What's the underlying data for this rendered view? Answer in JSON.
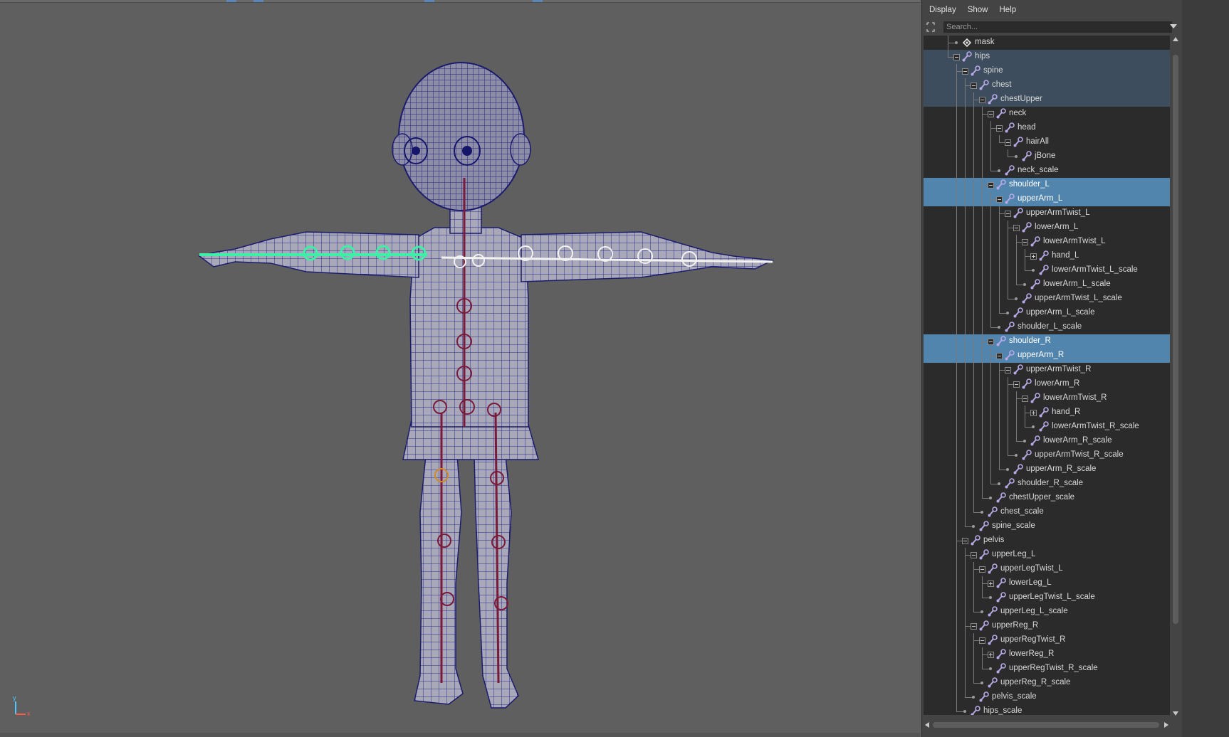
{
  "outliner": {
    "menu": [
      "Display",
      "Show",
      "Help"
    ],
    "search": {
      "placeholder": "Search..."
    },
    "rows": [
      {
        "label": "mask",
        "depth": 1,
        "icon": "transform-icon",
        "state": "leaf",
        "sel": 0
      },
      {
        "label": "hips",
        "depth": 1,
        "icon": "joint-icon",
        "state": "open",
        "sel": 1
      },
      {
        "label": "spine",
        "depth": 2,
        "icon": "joint-icon",
        "state": "open",
        "sel": 1
      },
      {
        "label": "chest",
        "depth": 3,
        "icon": "joint-icon",
        "state": "open",
        "sel": 1
      },
      {
        "label": "chestUpper",
        "depth": 4,
        "icon": "joint-icon",
        "state": "open",
        "sel": 1
      },
      {
        "label": "neck",
        "depth": 5,
        "icon": "joint-icon",
        "state": "open",
        "sel": 0
      },
      {
        "label": "head",
        "depth": 6,
        "icon": "joint-icon",
        "state": "open",
        "sel": 0
      },
      {
        "label": "hairAll",
        "depth": 7,
        "icon": "joint-icon",
        "state": "open",
        "sel": 0
      },
      {
        "label": "jBone",
        "depth": 8,
        "icon": "joint-icon",
        "state": "leaf",
        "sel": 0
      },
      {
        "label": "neck_scale",
        "depth": 6,
        "icon": "joint-icon",
        "state": "leaf",
        "sel": 0
      },
      {
        "label": "shoulder_L",
        "depth": 5,
        "icon": "joint-icon",
        "state": "open",
        "sel": 2
      },
      {
        "label": "upperArm_L",
        "depth": 6,
        "icon": "joint-icon",
        "state": "open",
        "sel": 2
      },
      {
        "label": "upperArmTwist_L",
        "depth": 7,
        "icon": "joint-icon",
        "state": "open",
        "sel": 0
      },
      {
        "label": "lowerArm_L",
        "depth": 8,
        "icon": "joint-icon",
        "state": "open",
        "sel": 0
      },
      {
        "label": "lowerArmTwist_L",
        "depth": 9,
        "icon": "joint-icon",
        "state": "open",
        "sel": 0
      },
      {
        "label": "hand_L",
        "depth": 10,
        "icon": "joint-icon",
        "state": "closed",
        "sel": 0
      },
      {
        "label": "lowerArmTwist_L_scale",
        "depth": 10,
        "icon": "joint-icon",
        "state": "leaf",
        "sel": 0
      },
      {
        "label": "lowerArm_L_scale",
        "depth": 9,
        "icon": "joint-icon",
        "state": "leaf",
        "sel": 0
      },
      {
        "label": "upperArmTwist_L_scale",
        "depth": 8,
        "icon": "joint-icon",
        "state": "leaf",
        "sel": 0
      },
      {
        "label": "upperArm_L_scale",
        "depth": 7,
        "icon": "joint-icon",
        "state": "leaf",
        "sel": 0
      },
      {
        "label": "shoulder_L_scale",
        "depth": 6,
        "icon": "joint-icon",
        "state": "leaf",
        "sel": 0
      },
      {
        "label": "shoulder_R",
        "depth": 5,
        "icon": "joint-icon",
        "state": "open",
        "sel": 2
      },
      {
        "label": "upperArm_R",
        "depth": 6,
        "icon": "joint-icon",
        "state": "open",
        "sel": 2
      },
      {
        "label": "upperArmTwist_R",
        "depth": 7,
        "icon": "joint-icon",
        "state": "open",
        "sel": 0
      },
      {
        "label": "lowerArm_R",
        "depth": 8,
        "icon": "joint-icon",
        "state": "open",
        "sel": 0
      },
      {
        "label": "lowerArmTwist_R",
        "depth": 9,
        "icon": "joint-icon",
        "state": "open",
        "sel": 0
      },
      {
        "label": "hand_R",
        "depth": 10,
        "icon": "joint-icon",
        "state": "closed",
        "sel": 0
      },
      {
        "label": "lowerArmTwist_R_scale",
        "depth": 10,
        "icon": "joint-icon",
        "state": "leaf",
        "sel": 0
      },
      {
        "label": "lowerArm_R_scale",
        "depth": 9,
        "icon": "joint-icon",
        "state": "leaf",
        "sel": 0
      },
      {
        "label": "upperArmTwist_R_scale",
        "depth": 8,
        "icon": "joint-icon",
        "state": "leaf",
        "sel": 0
      },
      {
        "label": "upperArm_R_scale",
        "depth": 7,
        "icon": "joint-icon",
        "state": "leaf",
        "sel": 0
      },
      {
        "label": "shoulder_R_scale",
        "depth": 6,
        "icon": "joint-icon",
        "state": "leaf",
        "sel": 0
      },
      {
        "label": "chestUpper_scale",
        "depth": 5,
        "icon": "joint-icon",
        "state": "leaf",
        "sel": 0
      },
      {
        "label": "chest_scale",
        "depth": 4,
        "icon": "joint-icon",
        "state": "leaf",
        "sel": 0
      },
      {
        "label": "spine_scale",
        "depth": 3,
        "icon": "joint-icon",
        "state": "leaf",
        "sel": 0
      },
      {
        "label": "pelvis",
        "depth": 2,
        "icon": "joint-icon",
        "state": "open",
        "sel": 0
      },
      {
        "label": "upperLeg_L",
        "depth": 3,
        "icon": "joint-icon",
        "state": "open",
        "sel": 0
      },
      {
        "label": "upperLegTwist_L",
        "depth": 4,
        "icon": "joint-icon",
        "state": "open",
        "sel": 0
      },
      {
        "label": "lowerLeg_L",
        "depth": 5,
        "icon": "joint-icon",
        "state": "closed",
        "sel": 0
      },
      {
        "label": "upperLegTwist_L_scale",
        "depth": 5,
        "icon": "joint-icon",
        "state": "leaf",
        "sel": 0
      },
      {
        "label": "upperLeg_L_scale",
        "depth": 4,
        "icon": "joint-icon",
        "state": "leaf",
        "sel": 0
      },
      {
        "label": "upperReg_R",
        "depth": 3,
        "icon": "joint-icon",
        "state": "open",
        "sel": 0
      },
      {
        "label": "upperRegTwist_R",
        "depth": 4,
        "icon": "joint-icon",
        "state": "open",
        "sel": 0
      },
      {
        "label": "lowerReg_R",
        "depth": 5,
        "icon": "joint-icon",
        "state": "closed",
        "sel": 0
      },
      {
        "label": "upperRegTwist_R_scale",
        "depth": 5,
        "icon": "joint-icon",
        "state": "leaf",
        "sel": 0
      },
      {
        "label": "upperReg_R_scale",
        "depth": 4,
        "icon": "joint-icon",
        "state": "leaf",
        "sel": 0
      },
      {
        "label": "pelvis_scale",
        "depth": 3,
        "icon": "joint-icon",
        "state": "leaf",
        "sel": 0
      },
      {
        "label": "hips_scale",
        "depth": 2,
        "icon": "joint-icon",
        "state": "leaf",
        "sel": 0
      }
    ]
  },
  "viewport": {
    "axis_labels": {
      "y": "y",
      "x": "x"
    }
  },
  "colors": {
    "viewport_bg": "#5f5f5f",
    "mesh_fill": "#a9a8b8",
    "wireframe": "#2c2c8e",
    "joint_selected": "#3cf0a8",
    "joint_bone": "#7a1a3a",
    "selection_light": "#3d4d5d",
    "selection_strong": "#5285ad",
    "joint_icon": "#b6a9e6"
  }
}
